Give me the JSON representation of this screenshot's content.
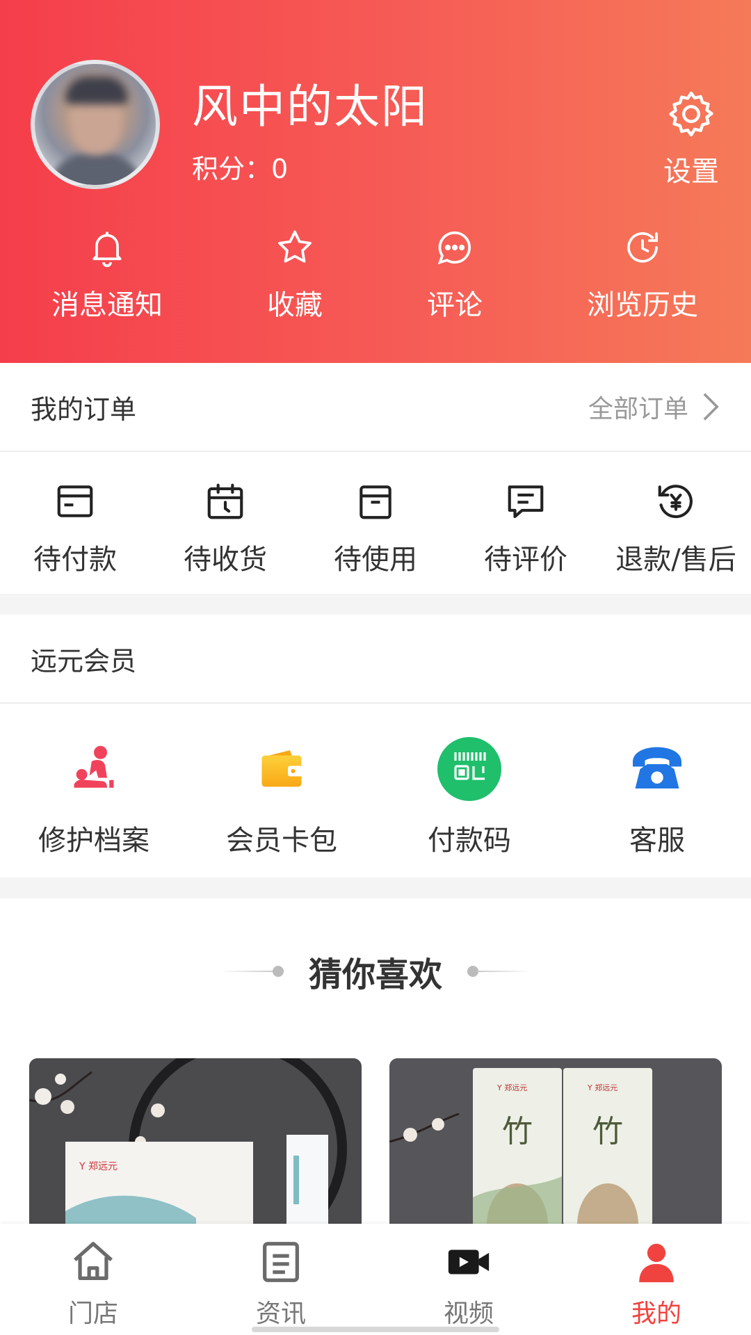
{
  "profile": {
    "name": "风中的太阳",
    "points_label": "积分：",
    "points_value": "0",
    "settings_label": "设置"
  },
  "quick_links": [
    {
      "label": "消息通知",
      "icon": "bell-icon"
    },
    {
      "label": "收藏",
      "icon": "star-icon"
    },
    {
      "label": "评论",
      "icon": "comment-icon"
    },
    {
      "label": "浏览历史",
      "icon": "history-icon"
    }
  ],
  "orders": {
    "title": "我的订单",
    "all_label": "全部订单",
    "items": [
      {
        "label": "待付款",
        "icon": "card-icon"
      },
      {
        "label": "待收货",
        "icon": "calendar-icon"
      },
      {
        "label": "待使用",
        "icon": "box-icon"
      },
      {
        "label": "待评价",
        "icon": "review-icon"
      },
      {
        "label": "退款/售后",
        "icon": "refund-icon"
      }
    ]
  },
  "member": {
    "title": "远元会员",
    "items": [
      {
        "label": "修护档案",
        "icon": "massage-icon",
        "color": "#f0435b"
      },
      {
        "label": "会员卡包",
        "icon": "wallet-icon",
        "color": "#f9b21a"
      },
      {
        "label": "付款码",
        "icon": "qr-code-icon",
        "color": "#1fbf6c"
      },
      {
        "label": "客服",
        "icon": "phone-icon",
        "color": "#2176e3"
      }
    ]
  },
  "guess": {
    "title": "猜你喜欢"
  },
  "tabs": [
    {
      "label": "门店",
      "icon": "home-icon"
    },
    {
      "label": "资讯",
      "icon": "news-icon"
    },
    {
      "label": "视频",
      "icon": "video-icon"
    },
    {
      "label": "我的",
      "icon": "user-icon",
      "active": true
    }
  ],
  "colors": {
    "header_start": "#f53e4b",
    "header_end": "#f57a58",
    "accent": "#f0433f"
  }
}
